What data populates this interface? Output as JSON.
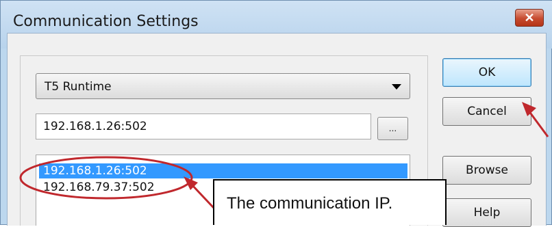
{
  "window": {
    "title": "Communication Settings",
    "close_label": "✕"
  },
  "protocol": {
    "selected": "T5 Runtime"
  },
  "address": {
    "value": "192.168.1.26:502",
    "browse_ellipsis": "..."
  },
  "address_list": {
    "items": [
      "192.168.1.26:502",
      "192.168.79.37:502"
    ],
    "selected_index": 0
  },
  "buttons": {
    "ok": "OK",
    "cancel": "Cancel",
    "browse": "Browse",
    "help": "Help"
  },
  "annotation": {
    "callout_text": "The communication IP.",
    "color": "#c0282d"
  }
}
